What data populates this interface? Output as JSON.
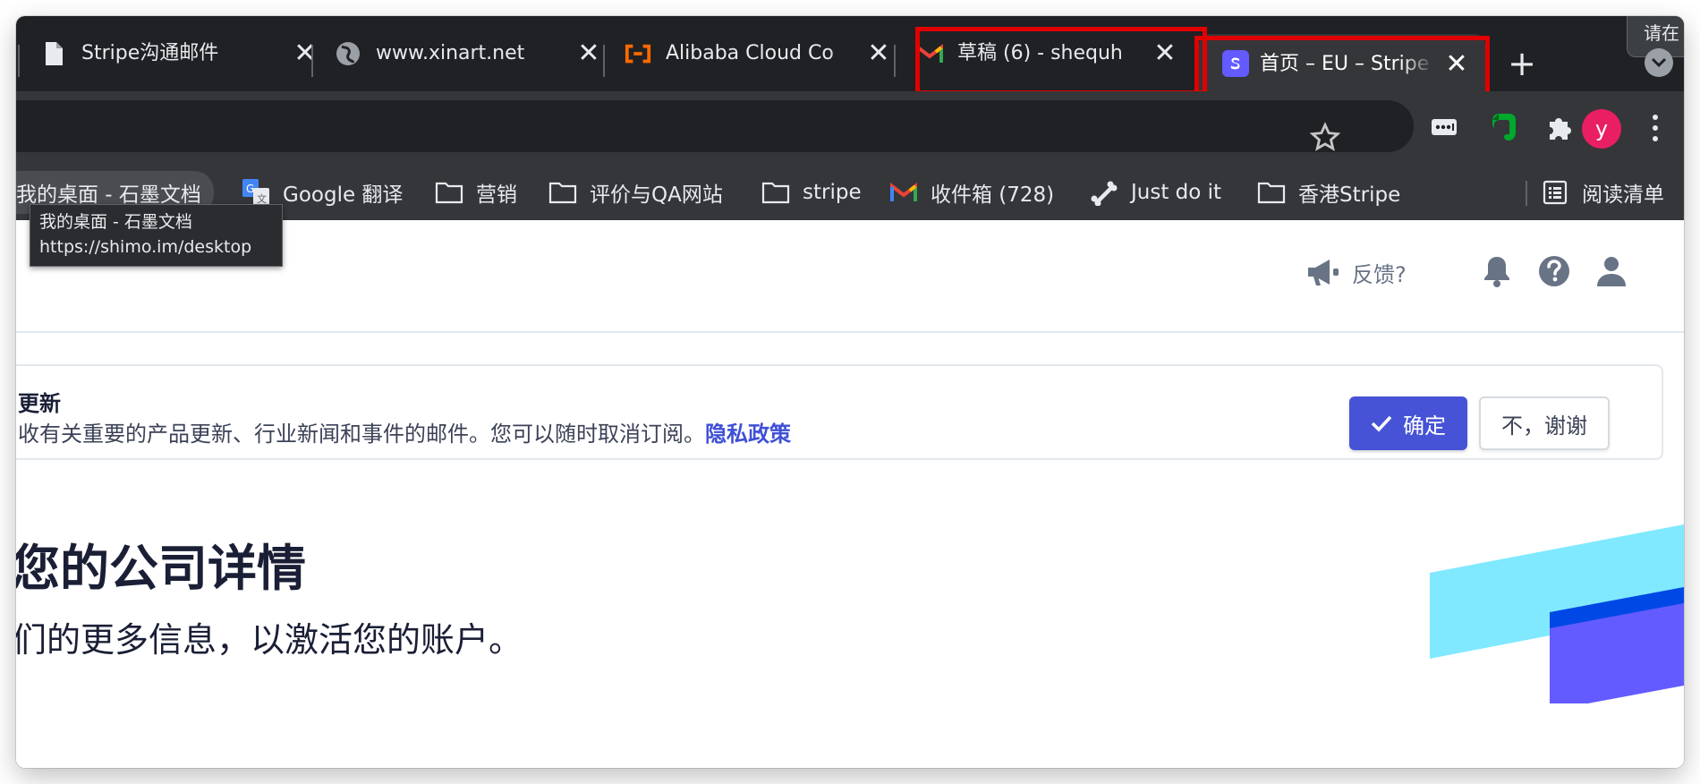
{
  "tabs": [
    {
      "title": "Stripe沟通邮件",
      "favicon": "document-icon"
    },
    {
      "title": "www.xinart.net",
      "favicon": "globe-icon"
    },
    {
      "title": "Alibaba Cloud Co",
      "favicon": "alibaba-cloud-icon"
    },
    {
      "title": "草稿 (6) - shequh",
      "favicon": "gmail-icon"
    },
    {
      "title": "首页 – EU – Stripe",
      "favicon": "stripe-icon",
      "active": true
    }
  ],
  "tab_close_glyph": "✕",
  "new_tab_glyph": "+",
  "corner_tooltip": "请在",
  "avatar_letter": "y",
  "bookmarks": [
    {
      "label": "我的桌面 - 石墨文档",
      "icon": "shimo-icon"
    },
    {
      "label": "Google 翻译",
      "icon": "google-translate-icon"
    },
    {
      "label": "营销",
      "icon": "folder-icon"
    },
    {
      "label": "评价与QA网站",
      "icon": "folder-icon"
    },
    {
      "label": "stripe",
      "icon": "folder-icon"
    },
    {
      "label": "收件箱 (728)",
      "icon": "gmail-icon"
    },
    {
      "label": "Just do it",
      "icon": "bone-icon"
    },
    {
      "label": "香港Stripe",
      "icon": "folder-icon"
    }
  ],
  "reading_list": "阅读清单",
  "url_tooltip": {
    "title": "我的桌面 - 石墨文档",
    "url": "https://shimo.im/desktop"
  },
  "header": {
    "feedback": "反馈?"
  },
  "consent": {
    "title": "更新",
    "text": "收有关重要的产品更新、行业新闻和事件的邮件。您可以随时取消订阅。",
    "link": "隐私政策",
    "confirm": "确定",
    "decline": "不，谢谢"
  },
  "main": {
    "heading": "您的公司详情",
    "subheading": "们的更多信息，以激活您的账户。"
  },
  "colors": {
    "accent": "#4653d6",
    "highlight": "#e00000",
    "stripe_cyan": "#80e9ff",
    "stripe_blue": "#0048e5",
    "stripe_purple": "#635bff"
  }
}
